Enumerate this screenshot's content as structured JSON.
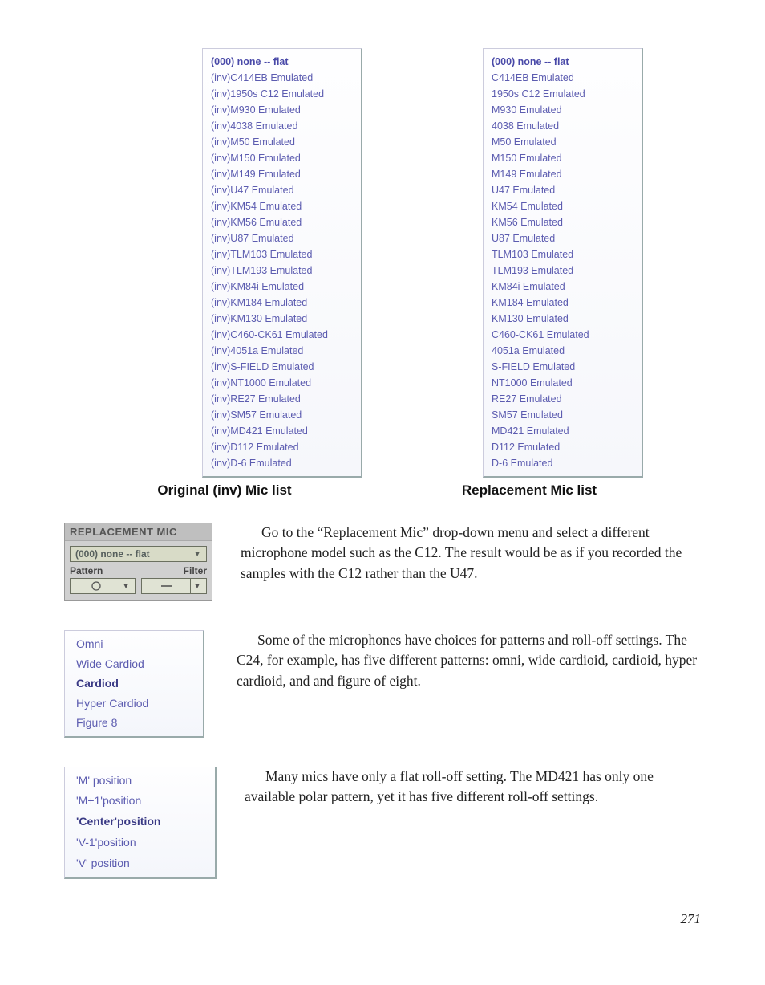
{
  "original_mic_list": {
    "header": "(000) none -- flat",
    "items": [
      "(inv)C414EB Emulated",
      "(inv)1950s C12 Emulated",
      "(inv)M930 Emulated",
      "(inv)4038 Emulated",
      "(inv)M50 Emulated",
      "(inv)M150 Emulated",
      "(inv)M149 Emulated",
      "(inv)U47 Emulated",
      "(inv)KM54 Emulated",
      "(inv)KM56 Emulated",
      "(inv)U87 Emulated",
      "(inv)TLM103 Emulated",
      "(inv)TLM193 Emulated",
      "(inv)KM84i Emulated",
      "(inv)KM184 Emulated",
      "(inv)KM130 Emulated",
      "(inv)C460-CK61 Emulated",
      "(inv)4051a Emulated",
      "(inv)S-FIELD Emulated",
      "(inv)NT1000 Emulated",
      "(inv)RE27 Emulated",
      "(inv)SM57 Emulated",
      "(inv)MD421 Emulated",
      "(inv)D112 Emulated",
      "(inv)D-6 Emulated"
    ]
  },
  "replacement_mic_list": {
    "header": "(000) none -- flat",
    "items": [
      "C414EB Emulated",
      "1950s C12 Emulated",
      "M930 Emulated",
      "4038 Emulated",
      "M50 Emulated",
      "M150 Emulated",
      "M149 Emulated",
      "U47 Emulated",
      "KM54 Emulated",
      "KM56 Emulated",
      "U87 Emulated",
      "TLM103 Emulated",
      "TLM193 Emulated",
      "KM84i Emulated",
      "KM184 Emulated",
      "KM130 Emulated",
      "C460-CK61 Emulated",
      "4051a Emulated",
      "S-FIELD Emulated",
      "NT1000 Emulated",
      "RE27 Emulated",
      "SM57 Emulated",
      "MD421 Emulated",
      "D112 Emulated",
      "D-6 Emulated"
    ]
  },
  "captions": {
    "original": "Original (inv) Mic list",
    "replacement": "Replacement Mic list"
  },
  "replacement_panel": {
    "title": "REPLACEMENT MIC",
    "selected": "(000) none -- flat",
    "pattern_label": "Pattern",
    "filter_label": "Filter"
  },
  "paragraphs": {
    "p1": "Go to the “Replacement Mic” drop-down menu and select a different microphone model such as the C12. The result would be as if you recorded the samples with the C12 rather than the U47.",
    "p2": "Some of the microphones have choices for patterns and roll-off settings. The C24, for example, has five different patterns: omni, wide cardioid, cardioid, hyper cardioid, and and figure of eight.",
    "p3": "Many mics have only a flat roll-off setting. The MD421 has only one available polar pattern, yet it has five different roll-off settings."
  },
  "pattern_list": {
    "items": [
      "Omni",
      "Wide Cardiod",
      "Cardiod",
      "Hyper Cardiod",
      "Figure 8"
    ],
    "selected_index": 2
  },
  "rolloff_list": {
    "items": [
      "'M' position",
      "'M+1'position",
      "'Center'position",
      "'V-1'position",
      "'V' position"
    ],
    "selected_index": 2
  },
  "page_number": "271"
}
